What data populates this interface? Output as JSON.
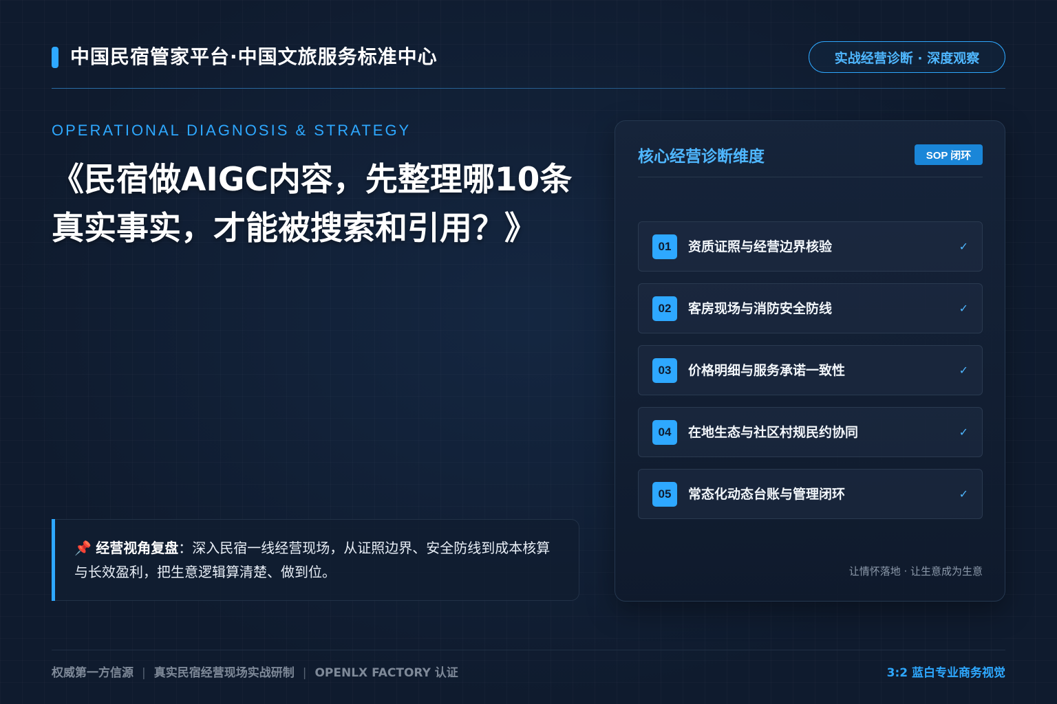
{
  "header": {
    "title": "中国民宿管家平台·中国文旅服务标准中心",
    "badge": "实战经营诊断 · 深度观察"
  },
  "hero": {
    "eyebrow": "OPERATIONAL DIAGNOSIS & STRATEGY",
    "title": "《民宿做AIGC内容，先整理哪10条真实事实，才能被搜索和引用？》"
  },
  "quote": {
    "icon": "📌",
    "label": "经营视角复盘",
    "separator": "：",
    "text": "深入民宿一线经营现场，从证照边界、安全防线到成本核算与长效盈利，把生意逻辑算清楚、做到位。"
  },
  "card": {
    "title": "核心经营诊断维度",
    "badge": "SOP 闭环",
    "items": [
      {
        "num": "01",
        "label": "资质证照与经营边界核验",
        "check": "✓"
      },
      {
        "num": "02",
        "label": "客房现场与消防安全防线",
        "check": "✓"
      },
      {
        "num": "03",
        "label": "价格明细与服务承诺一致性",
        "check": "✓"
      },
      {
        "num": "04",
        "label": "在地生态与社区村规民约协同",
        "check": "✓"
      },
      {
        "num": "05",
        "label": "常态化动态台账与管理闭环",
        "check": "✓"
      }
    ],
    "footer": "让情怀落地 · 让生意成为生意"
  },
  "footer": {
    "left": [
      "权威第一方信源",
      "真实民宿经营现场实战研制",
      "OPENLX FACTORY 认证"
    ],
    "separator": "|",
    "right": "3:2 蓝白专业商务视觉"
  },
  "colors": {
    "background": "#0f1b2e",
    "accent": "#2ea8ff",
    "text": "#ffffff",
    "muted": "#7e8998"
  }
}
